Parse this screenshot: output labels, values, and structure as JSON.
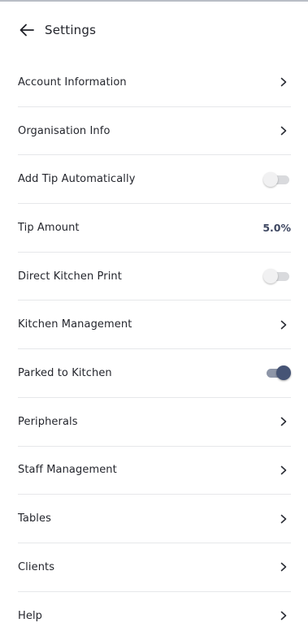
{
  "header": {
    "title": "Settings"
  },
  "colors": {
    "accent": "#465475",
    "value_text": "#3e4761",
    "divider": "#e6e7ea"
  },
  "settings": {
    "account_information": {
      "label": "Account Information",
      "control": "chevron"
    },
    "organisation_info": {
      "label": "Organisation Info",
      "control": "chevron"
    },
    "add_tip_automatically": {
      "label": "Add Tip Automatically",
      "control": "toggle",
      "enabled": false
    },
    "tip_amount": {
      "label": "Tip Amount",
      "control": "value",
      "value": "5.0%"
    },
    "direct_kitchen_print": {
      "label": "Direct Kitchen Print",
      "control": "toggle",
      "enabled": false
    },
    "kitchen_management": {
      "label": "Kitchen Management",
      "control": "chevron"
    },
    "parked_to_kitchen": {
      "label": "Parked to Kitchen",
      "control": "toggle",
      "enabled": true
    },
    "peripherals": {
      "label": "Peripherals",
      "control": "chevron"
    },
    "staff_management": {
      "label": "Staff Management",
      "control": "chevron"
    },
    "tables": {
      "label": "Tables",
      "control": "chevron"
    },
    "clients": {
      "label": "Clients",
      "control": "chevron"
    },
    "help": {
      "label": "Help",
      "control": "chevron"
    }
  }
}
